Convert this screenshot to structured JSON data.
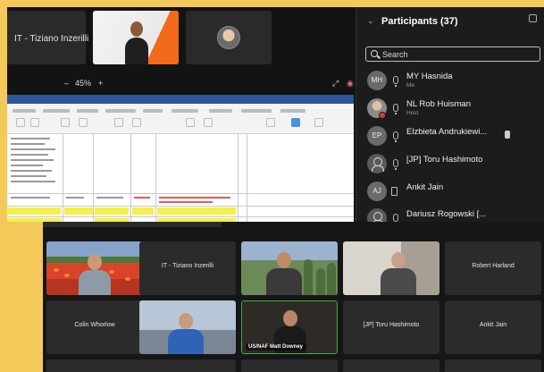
{
  "meeting": {
    "top_tiles": [
      {
        "name": "IT - Tiziano Inzerilli"
      }
    ],
    "toolbar": {
      "zoom_minus": "–",
      "zoom_value": "45%",
      "zoom_plus": "+"
    }
  },
  "participants_panel": {
    "title": "Participants (37)",
    "search_placeholder": "Search",
    "items": [
      {
        "initials": "MH",
        "name": "MY Hasnida",
        "sub": "Me",
        "audio": "mic"
      },
      {
        "initials": "",
        "name": "NL Rob Huisman",
        "sub": "Host",
        "audio": "mic",
        "photo": true
      },
      {
        "initials": "EP",
        "name": "Elzbieta Andrukiewi...",
        "sub": "",
        "audio": "mic",
        "sharing": true
      },
      {
        "initials": "",
        "name": "[JP] Toru Hashimoto",
        "sub": "",
        "audio": "mic",
        "guest": true
      },
      {
        "initials": "AJ",
        "name": "Ankit Jain",
        "sub": "",
        "audio": "phone"
      },
      {
        "initials": "",
        "name": "Dariusz Rogowski [...",
        "sub": "",
        "audio": "mic",
        "guest": true
      }
    ]
  },
  "gallery": {
    "tiles": [
      {
        "name": "",
        "kind": "flowers"
      },
      {
        "name": "IT - Tiziano Inzerilli",
        "kind": "name"
      },
      {
        "name": "",
        "kind": "garden"
      },
      {
        "name": "",
        "kind": "room1"
      },
      {
        "name": "Robert Harland",
        "kind": "name"
      },
      {
        "name": "Colin Whorlow",
        "kind": "name"
      },
      {
        "name": "",
        "kind": "room2"
      },
      {
        "name": "US/NAF Matt Downey",
        "kind": "active"
      },
      {
        "name": "[JP] Toru Hashimoto",
        "kind": "name"
      },
      {
        "name": "Ankit Jain",
        "kind": "name"
      }
    ]
  },
  "colors": {
    "background": "#f4c95a",
    "panel": "#1c1c1c",
    "tile": "#2b2b2b",
    "active_speaker": "#3fae4c",
    "status_red": "#d43c3c"
  }
}
